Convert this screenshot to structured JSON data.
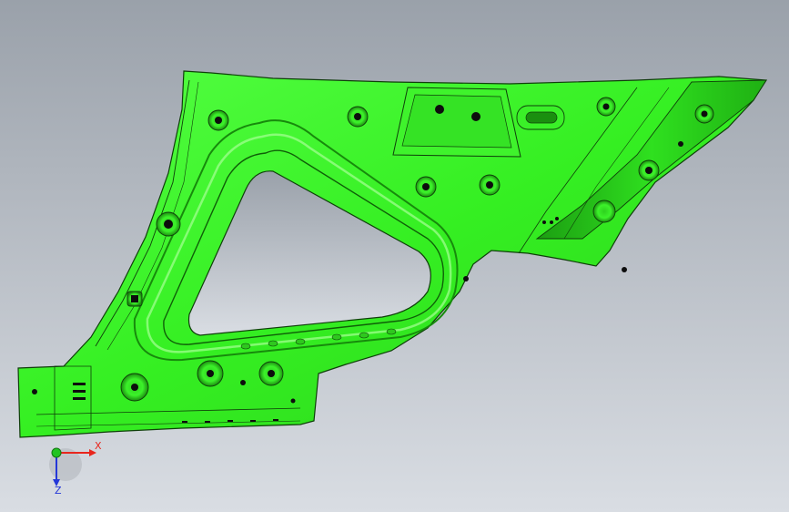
{
  "viewport": {
    "background_top": "#9aa1aa",
    "background_bottom": "#d9dde3"
  },
  "part": {
    "color": "#33ee22",
    "shadow_color": "#1aa50f",
    "edge_color": "#0f3f0a",
    "highlight_color": "#a6ff96"
  },
  "triad": {
    "x_label": "X",
    "z_label": "Z",
    "x_color": "#e8261d",
    "y_color": "#22c322",
    "z_color": "#2437d8"
  }
}
